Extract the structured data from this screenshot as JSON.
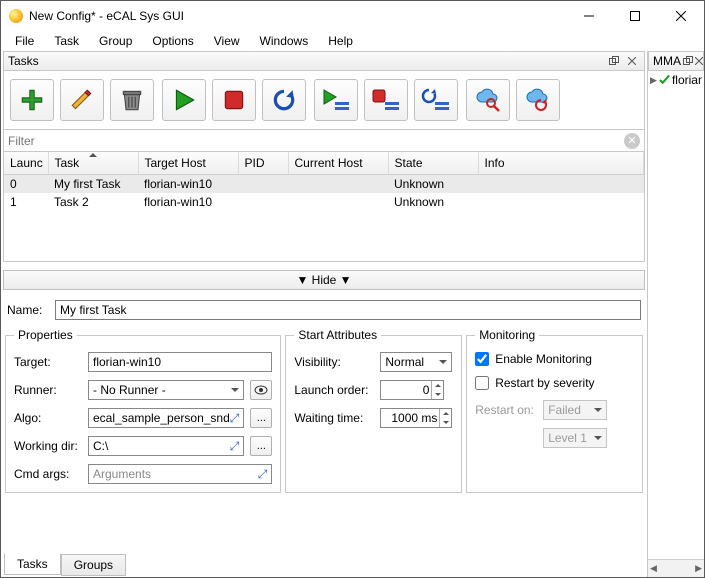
{
  "window": {
    "title": "New Config* - eCAL Sys GUI"
  },
  "menu": [
    "File",
    "Task",
    "Group",
    "Options",
    "View",
    "Windows",
    "Help"
  ],
  "panels": {
    "tasks_title": "Tasks",
    "mma_title": "MMA"
  },
  "filter": {
    "placeholder": "Filter"
  },
  "columns": [
    "Launc",
    "Task",
    "Target Host",
    "PID",
    "Current Host",
    "State",
    "Info"
  ],
  "rows": [
    {
      "launch": "0",
      "task": "My first Task",
      "target": "florian-win10",
      "pid": "",
      "current": "",
      "state": "Unknown",
      "info": ""
    },
    {
      "launch": "1",
      "task": "Task 2",
      "target": "florian-win10",
      "pid": "",
      "current": "",
      "state": "Unknown",
      "info": ""
    }
  ],
  "hide_label": "▼ Hide ▼",
  "name": {
    "label": "Name:",
    "value": "My first Task"
  },
  "props": {
    "legend": "Properties",
    "target": {
      "label": "Target:",
      "value": "florian-win10"
    },
    "runner": {
      "label": "Runner:",
      "value": "- No Runner -"
    },
    "algo": {
      "label": "Algo:",
      "value": "ecal_sample_person_snd"
    },
    "wdir": {
      "label": "Working dir:",
      "value": "C:\\"
    },
    "cmd": {
      "label": "Cmd args:",
      "placeholder": "Arguments"
    },
    "browse": "...",
    "expand": "⤢"
  },
  "start": {
    "legend": "Start Attributes",
    "visibility": {
      "label": "Visibility:",
      "value": "Normal"
    },
    "order": {
      "label": "Launch order:",
      "value": "0"
    },
    "wait": {
      "label": "Waiting time:",
      "value": "1000 ms"
    }
  },
  "mon": {
    "legend": "Monitoring",
    "enable": "Enable Monitoring",
    "restart_sev": "Restart by severity",
    "restart_on": {
      "label": "Restart on:",
      "v1": "Failed",
      "v2": "Level 1"
    }
  },
  "bottom_tabs": [
    "Tasks",
    "Groups"
  ],
  "mma_tree": {
    "node": "florian"
  }
}
